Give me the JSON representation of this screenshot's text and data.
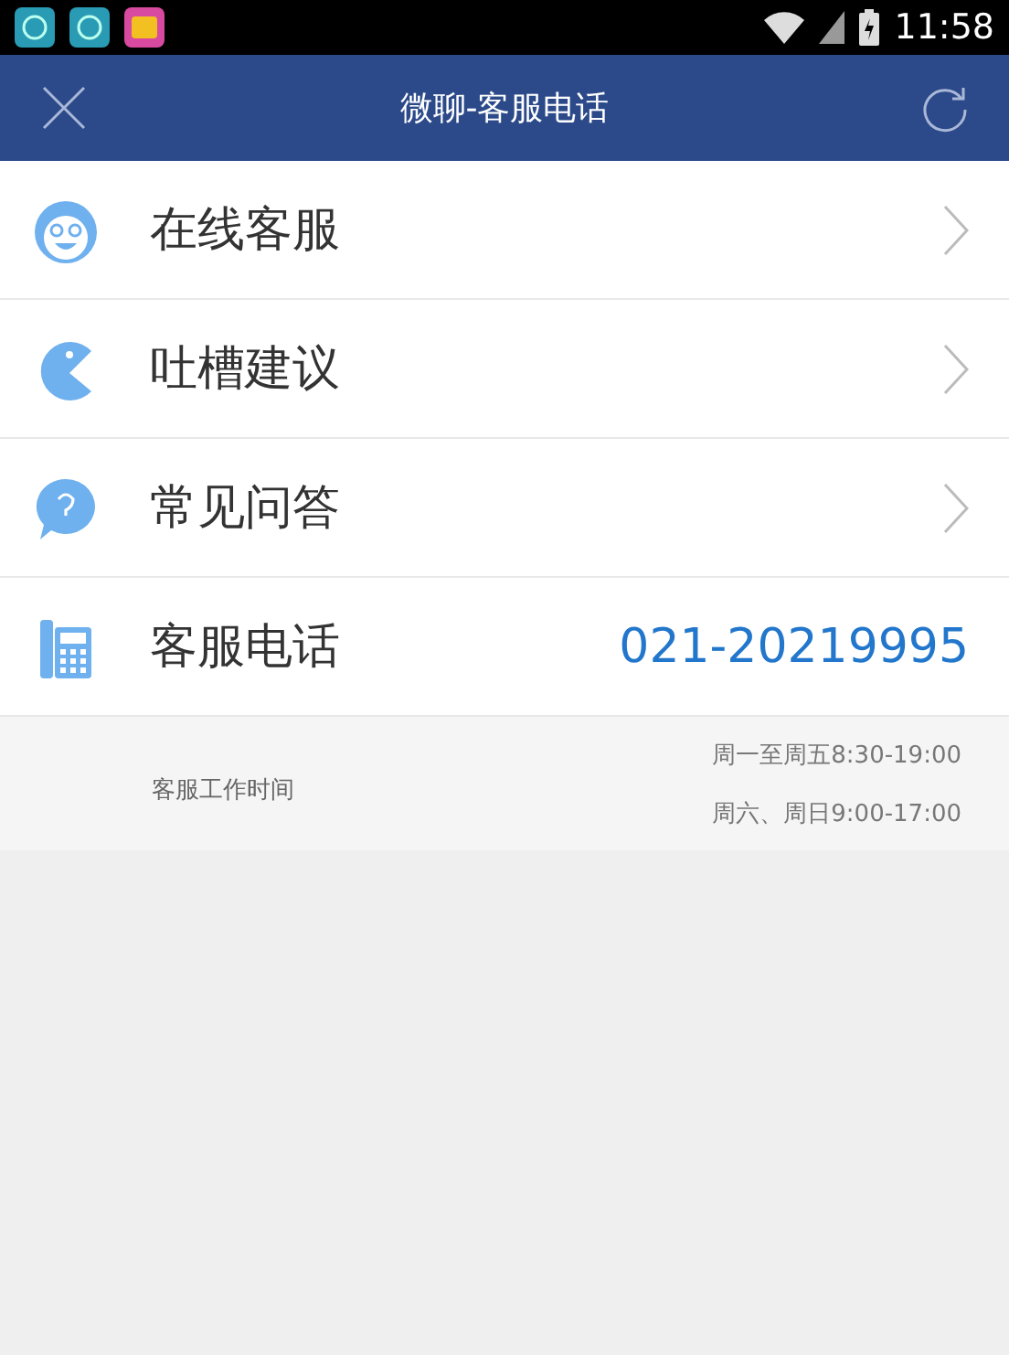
{
  "status_bar": {
    "time": "11:58"
  },
  "header": {
    "title": "微聊-客服电话"
  },
  "items": [
    {
      "kind": "link",
      "label": "在线客服"
    },
    {
      "kind": "link",
      "label": "吐槽建议"
    },
    {
      "kind": "link",
      "label": "常见问答"
    },
    {
      "kind": "phone",
      "label": "客服电话",
      "value": "021-20219995"
    }
  ],
  "hours": {
    "label": "客服工作时间",
    "lines": [
      "周一至周五8:30-19:00",
      "周六、周日9:00-17:00"
    ]
  }
}
